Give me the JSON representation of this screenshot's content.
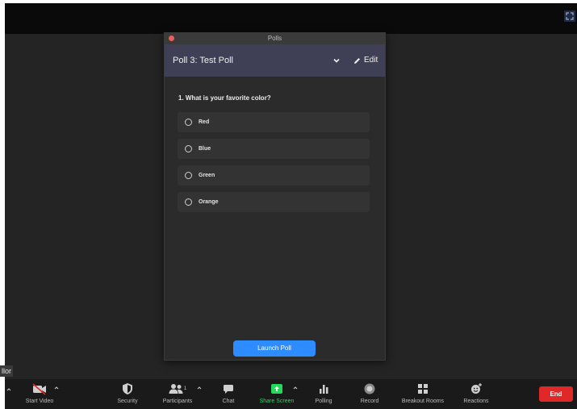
{
  "tooltip": "llor",
  "polls": {
    "window_title": "Polls",
    "poll_name": "Poll 3: Test Poll",
    "edit_label": "Edit",
    "question": "1. What is your favorite color?",
    "options": [
      "Red",
      "Blue",
      "Green",
      "Orange"
    ],
    "launch_label": "Launch Poll"
  },
  "toolbar": {
    "start_video": "Start Video",
    "security": "Security",
    "participants": "Participants",
    "participants_count": "1",
    "chat": "Chat",
    "share_screen": "Share Screen",
    "polling": "Polling",
    "record": "Record",
    "breakout_rooms": "Breakout Rooms",
    "reactions": "Reactions",
    "end": "End"
  },
  "colors": {
    "accent_blue": "#2d8cff",
    "share_green": "#23d959",
    "end_red": "#e02828",
    "header_bg": "#3f3f55"
  }
}
